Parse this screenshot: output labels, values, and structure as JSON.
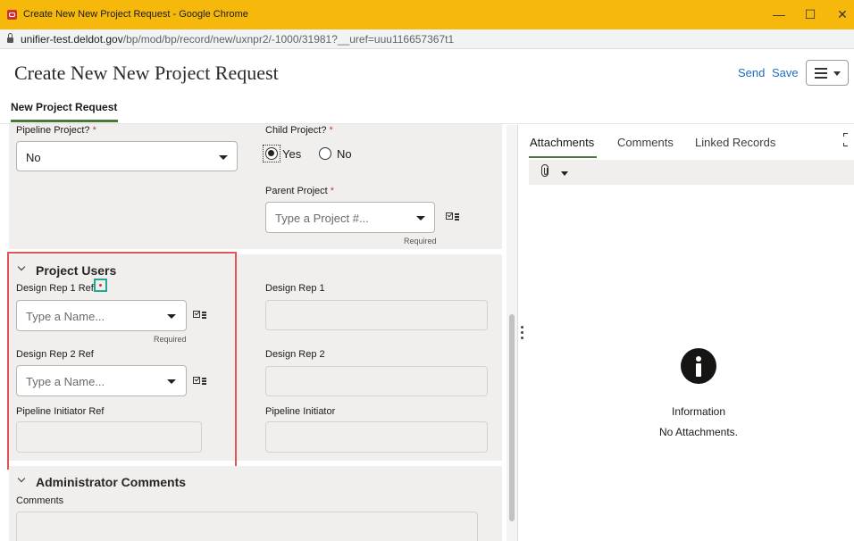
{
  "window": {
    "title": "Create New New Project Request - Google Chrome",
    "minimize": "—",
    "maximize": "☐",
    "close": "✕"
  },
  "browser": {
    "url_host": "unifier-test.deldot.gov",
    "url_path": "/bp/mod/bp/record/new/uxnpr2/-1000/31981?__uref=uuu116657367t1"
  },
  "header": {
    "title": "Create New New Project Request",
    "send_label": "Send",
    "save_label": "Save",
    "menu_icon": "hamburger-icon"
  },
  "tabs": {
    "main_tab": "New Project Request"
  },
  "form": {
    "pipeline_project": {
      "label": "Pipeline Project?",
      "required_mark": "*",
      "value": "No"
    },
    "child_project": {
      "label": "Child Project?",
      "required_mark": "*",
      "options": [
        "Yes",
        "No"
      ],
      "selected": "Yes"
    },
    "parent_project": {
      "label": "Parent Project",
      "required_mark": "*",
      "placeholder": "Type a Project #...",
      "hint": "Required"
    },
    "project_users": {
      "title": "Project Users",
      "design_rep_1_ref": {
        "label": "Design Rep 1 Ref",
        "placeholder": "Type a Name...",
        "hint": "Required"
      },
      "design_rep_1": {
        "label": "Design Rep 1"
      },
      "design_rep_2_ref": {
        "label": "Design Rep 2 Ref",
        "placeholder": "Type a Name..."
      },
      "design_rep_2": {
        "label": "Design Rep 2"
      },
      "pipeline_initiator_ref": {
        "label": "Pipeline Initiator Ref"
      },
      "pipeline_initiator": {
        "label": "Pipeline Initiator"
      }
    },
    "admin_comments": {
      "title": "Administrator Comments",
      "comments_label": "Comments"
    }
  },
  "side_panel": {
    "tabs": [
      "Attachments",
      "Comments",
      "Linked Records"
    ],
    "active_tab": "Attachments",
    "toolbar_icon": "paperclip-icon",
    "empty_title": "Information",
    "empty_message": "No Attachments."
  },
  "colors": {
    "title_bar": "#f6b90b",
    "link": "#1d6cc3",
    "accent_underline": "#4a7a3a",
    "panel_bg": "#f1efed",
    "required": "#c73a3a",
    "highlight_red": "#e05555",
    "highlight_teal": "#1ea896"
  }
}
